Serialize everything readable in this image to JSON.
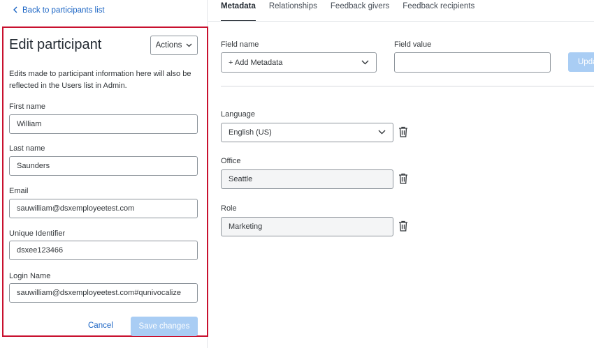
{
  "back_link": "Back to participants list",
  "panel": {
    "title": "Edit participant",
    "actions_label": "Actions",
    "note": "Edits made to participant information here will also be reflected in the Users list in Admin.",
    "fields": [
      {
        "label": "First name",
        "value": "William"
      },
      {
        "label": "Last name",
        "value": "Saunders"
      },
      {
        "label": "Email",
        "value": "sauwilliam@dsxemployeetest.com"
      },
      {
        "label": "Unique Identifier",
        "value": "dsxee123466"
      },
      {
        "label": "Login Name",
        "value": "sauwilliam@dsxemployeetest.com#qunivocalize"
      }
    ],
    "cancel_label": "Cancel",
    "save_label": "Save changes"
  },
  "tabs": [
    {
      "label": "Metadata",
      "active": true
    },
    {
      "label": "Relationships",
      "active": false
    },
    {
      "label": "Feedback givers",
      "active": false
    },
    {
      "label": "Feedback recipients",
      "active": false
    }
  ],
  "metadata": {
    "field_name_label": "Field name",
    "field_name_value": "+ Add Metadata",
    "field_value_label": "Field value",
    "field_value_value": "",
    "update_label": "Update",
    "entries": [
      {
        "label": "Language",
        "value": "English (US)",
        "type": "select"
      },
      {
        "label": "Office",
        "value": "Seattle",
        "type": "input"
      },
      {
        "label": "Role",
        "value": "Marketing",
        "type": "input"
      }
    ]
  },
  "colors": {
    "accent": "#1a64c4",
    "highlight_border": "#c8102e",
    "disabled_button": "#a9cdf4"
  },
  "icons": [
    "chevron-left-icon",
    "chevron-down-icon",
    "trash-icon"
  ]
}
